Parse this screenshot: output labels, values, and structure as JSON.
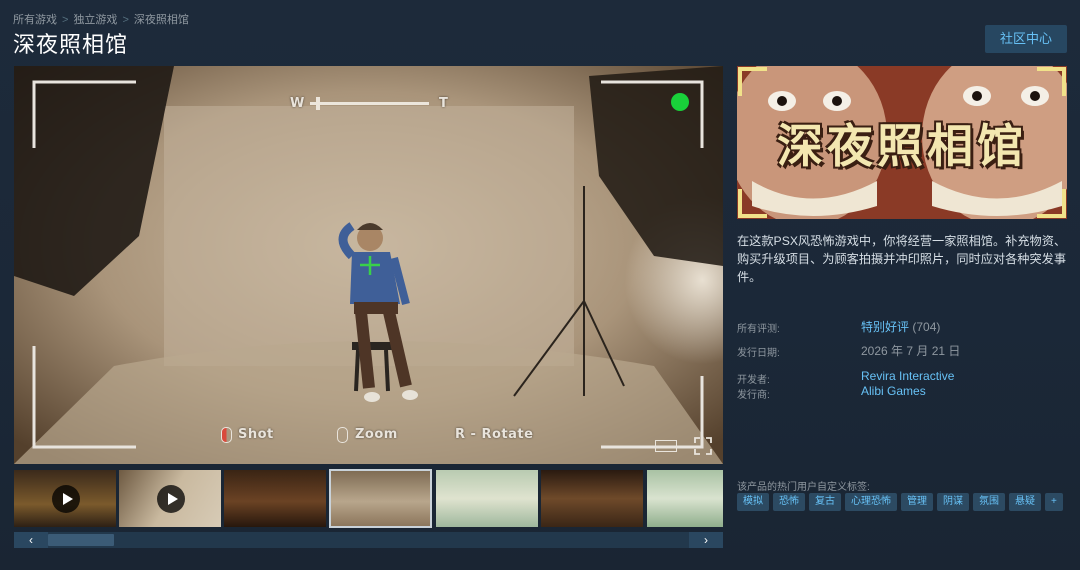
{
  "breadcrumb": [
    "所有游戏",
    "独立游戏",
    "深夜照相馆"
  ],
  "title": "深夜照相馆",
  "community_button": "社区中心",
  "hud": {
    "wide_label": "W",
    "tele_label": "T",
    "zoom_level": 0.05,
    "shot_label": "Shot",
    "zoom_label": "Zoom",
    "rotate_label": "R - Rotate"
  },
  "thumbnails": [
    {
      "kind": "video",
      "selected": false
    },
    {
      "kind": "video",
      "selected": false
    },
    {
      "kind": "image",
      "selected": false
    },
    {
      "kind": "image",
      "selected": true
    },
    {
      "kind": "image",
      "selected": false
    },
    {
      "kind": "image",
      "selected": false
    },
    {
      "kind": "image",
      "selected": false
    }
  ],
  "scroll": {
    "left_arrow": "‹",
    "right_arrow": "›"
  },
  "capsule": {
    "title": "深夜照相馆"
  },
  "description": "在这款PSX风恐怖游戏中，你将经营一家照相馆。补充物资、购买升级项目、为顾客拍摄并冲印照片，同时应对各种突发事件。",
  "reviews": {
    "label": "所有评测:",
    "summary": "特别好评",
    "count": "(704)"
  },
  "release": {
    "label": "发行日期:",
    "date": "2026 年 7 月 21 日"
  },
  "developer": {
    "label": "开发者:",
    "name": "Revira Interactive"
  },
  "publisher": {
    "label": "发行商:",
    "name": "Alibi Games"
  },
  "tags_label": "该产品的热门用户自定义标签:",
  "tags": [
    "模拟",
    "恐怖",
    "复古",
    "心理恐怖",
    "管理",
    "阴谋",
    "氛围",
    "悬疑",
    "+"
  ],
  "colors": {
    "accent": "#67c1f5",
    "record_dot": "#19d13a",
    "crosshair": "#39d14a"
  }
}
